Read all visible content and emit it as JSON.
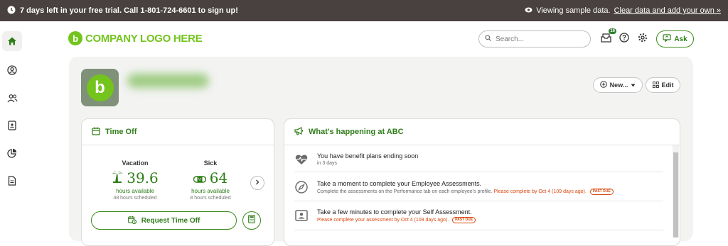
{
  "topbar": {
    "trial_text": "7 days left in your free trial. Call 1-801-724-6601 to sign up!",
    "viewing_text": "Viewing sample data.",
    "clear_link": "Clear data and add your own »"
  },
  "header": {
    "logo_text": "COMPANY LOGO HERE",
    "search_placeholder": "Search...",
    "inbox_badge": "16",
    "ask_label": "Ask"
  },
  "profile": {
    "new_label": "New...",
    "edit_label": "Edit"
  },
  "time_off": {
    "title": "Time Off",
    "vacation": {
      "label": "Vacation",
      "value": "39.6",
      "units": "hours available",
      "scheduled": "48 hours scheduled"
    },
    "sick": {
      "label": "Sick",
      "value": "64",
      "units": "hours available",
      "scheduled": "8 hours scheduled"
    },
    "request_label": "Request Time Off"
  },
  "happening": {
    "title": "What's happening at ABC",
    "items": [
      {
        "title": "You have benefit plans ending soon",
        "sub": "in 3 days",
        "warn": "",
        "pastdue": ""
      },
      {
        "title": "Take a moment to complete your Employee Assessments.",
        "sub": "Complete the assessments on the Performance tab on each employee's profile.",
        "warn": "Please complete by Oct 4 (109 days ago).",
        "pastdue": "PAST DUE"
      },
      {
        "title": "Take a few minutes to complete your Self Assessment.",
        "sub": "",
        "warn": "Please complete your assessment by Oct 4 (109 days ago).",
        "pastdue": "PAST DUE"
      }
    ]
  },
  "colors": {
    "brand_green": "#73c41d",
    "dark_green": "#2e7d18",
    "warning": "#d9480f",
    "topbar": "#48413f"
  }
}
